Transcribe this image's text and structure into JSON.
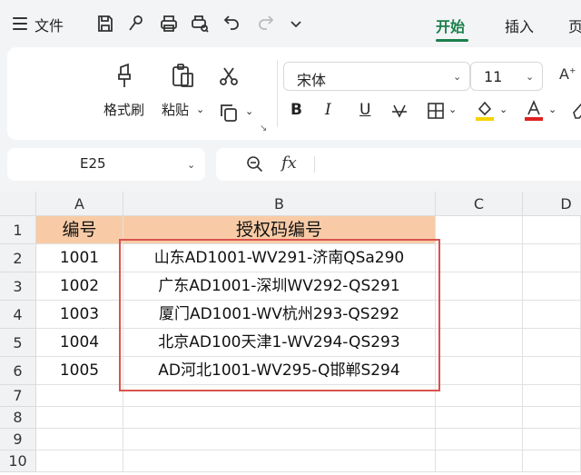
{
  "menu": {
    "file_label": "文件",
    "tabs": [
      {
        "label": "开始",
        "active": true
      },
      {
        "label": "插入",
        "active": false
      },
      {
        "label": "页",
        "active": false
      }
    ],
    "accent_color": "#1a7f4b"
  },
  "quick_access": [
    "save-icon",
    "format-brush-small-icon",
    "print-icon",
    "print-preview-icon",
    "undo-icon",
    "redo-icon",
    "more-chevron-icon"
  ],
  "ribbon": {
    "format_painter_label": "格式刷",
    "paste_label": "粘贴",
    "font_name": "宋体",
    "font_size": "11",
    "format_buttons": [
      "B",
      "I",
      "U"
    ],
    "highlight_color": "#f5d300",
    "font_color": "#e02020"
  },
  "formula_bar": {
    "cell_ref": "E25",
    "fx_label": "fx",
    "formula": ""
  },
  "sheet": {
    "columns": [
      "A",
      "B",
      "C",
      "D"
    ],
    "rows": [
      "1",
      "2",
      "3",
      "4",
      "5",
      "6",
      "7",
      "8",
      "9",
      "10"
    ],
    "header_fill": "#f8cba6",
    "header": [
      "编号",
      "授权码编号"
    ],
    "data": [
      [
        "1001",
        "山东AD1001-WV291-济南QSa290"
      ],
      [
        "1002",
        "广东AD1001-深圳WV292-QS291"
      ],
      [
        "1003",
        "厦门AD1001-WV杭州293-QS292"
      ],
      [
        "1004",
        "北京AD100天津1-WV294-QS293"
      ],
      [
        "1005",
        "AD河北1001-WV295-Q邯郸S294"
      ]
    ],
    "selection_color": "#d9534f"
  }
}
